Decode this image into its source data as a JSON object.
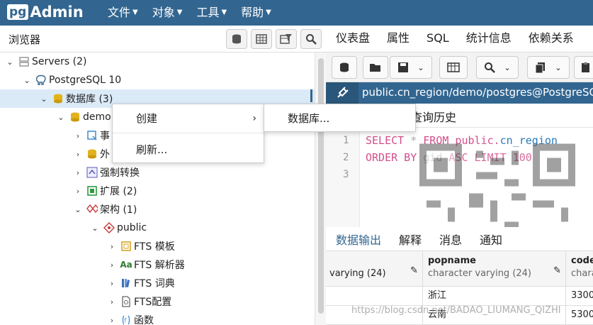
{
  "app": {
    "logo_pg": "pg",
    "logo_admin": "Admin"
  },
  "menu": [
    {
      "label": "文件"
    },
    {
      "label": "对象"
    },
    {
      "label": "工具"
    },
    {
      "label": "帮助"
    }
  ],
  "browser": {
    "title": "浏览器"
  },
  "tree": [
    {
      "label": "Servers (2)",
      "icon": "servers-icon"
    },
    {
      "label": "PostgreSQL 10",
      "icon": "postgres-elephant-icon"
    },
    {
      "label": "数据库 (3)",
      "icon": "databases-icon"
    },
    {
      "label": "demo",
      "icon": "database-icon"
    },
    {
      "label": "事",
      "icon": "event-trigger-icon"
    },
    {
      "label": "外",
      "icon": "foreign-data-icon"
    },
    {
      "label": "强制转换",
      "icon": "cast-icon"
    },
    {
      "label": "扩展 (2)",
      "icon": "extension-icon"
    },
    {
      "label": "架构 (1)",
      "icon": "schemas-icon"
    },
    {
      "label": "public",
      "icon": "schema-icon"
    },
    {
      "label": "FTS 模板",
      "icon": "fts-template-icon"
    },
    {
      "label": "FTS 解析器",
      "icon": "fts-parser-icon"
    },
    {
      "label": "FTS 词典",
      "icon": "fts-dictionary-icon"
    },
    {
      "label": "FTS配置",
      "icon": "fts-config-icon"
    },
    {
      "label": "函数",
      "icon": "function-icon"
    }
  ],
  "context_menu": {
    "create": "创建",
    "refresh": "刷新..."
  },
  "submenu": {
    "database": "数据库..."
  },
  "right_tabs": [
    {
      "label": "仪表盘"
    },
    {
      "label": "属性"
    },
    {
      "label": "SQL"
    },
    {
      "label": "统计信息"
    },
    {
      "label": "依赖关系"
    }
  ],
  "query": {
    "path": "public.cn_region/demo/postgres@PostgreSQL",
    "history_tab": "查询历史",
    "lines": [
      "1",
      "2",
      "3"
    ],
    "sql_line1": {
      "kw1": "SELECT",
      "star": " * ",
      "kw2": "FROM",
      "tbl": " public.",
      "name": "cn_region"
    },
    "sql_line2": {
      "kw1": "ORDER BY",
      "col": " gid ",
      "kw2": "ASC LIMIT",
      "num": " 100"
    }
  },
  "output_tabs": [
    {
      "label": "数据输出"
    },
    {
      "label": "解释"
    },
    {
      "label": "消息"
    },
    {
      "label": "通知"
    }
  ],
  "grid": {
    "col0_type": "varying (24)",
    "col1_name": "popname",
    "col1_type": "character varying (24)",
    "col2_name": "code",
    "col2_type": "chara",
    "rows": [
      {
        "popname": "浙江",
        "code": "3300"
      },
      {
        "popname": "云南",
        "code": "5300"
      }
    ]
  },
  "watermark": "https://blog.csdn.net/BADAO_LIUMANG_QIZHI"
}
